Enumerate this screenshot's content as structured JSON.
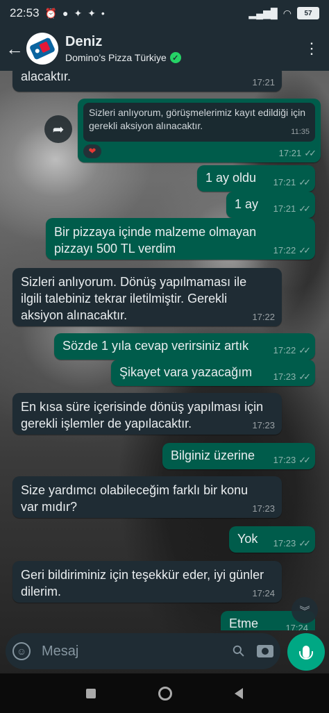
{
  "status": {
    "time": "22:53",
    "battery": "57"
  },
  "header": {
    "name": "Deniz",
    "subtitle": "Domino’s Pizza Türkiye"
  },
  "messages": [
    {
      "dir": "in",
      "text": "alacaktır.",
      "time": "17:21"
    },
    {
      "dir": "out",
      "quoted": "Sizleri anlıyorum, görüşmelerimiz kayıt edildiği için gerekli aksiyon alınacaktır.",
      "quoted_time": "11:35",
      "reaction": "❤",
      "time": "17:21"
    },
    {
      "dir": "out",
      "text": "1 ay oldu",
      "time": "17:21"
    },
    {
      "dir": "out",
      "text": "1 ay",
      "time": "17:21"
    },
    {
      "dir": "out",
      "text": "Bir pizzaya içinde malzeme olmayan pizzayı 500 TL verdim",
      "time": "17:22"
    },
    {
      "dir": "in",
      "text": "Sizleri anlıyorum. Dönüş yapılmaması ile ilgili talebiniz tekrar iletilmiştir. Gerekli aksiyon alınacaktır.",
      "time": "17:22"
    },
    {
      "dir": "out",
      "text": "Sözde 1 yıla cevap verirsiniz artık",
      "time": "17:22"
    },
    {
      "dir": "out",
      "text": "Şikayet vara yazacağım",
      "time": "17:23"
    },
    {
      "dir": "in",
      "text": "En kısa süre içerisinde dönüş yapılması için gerekli işlemler de yapılacaktır.",
      "time": "17:23"
    },
    {
      "dir": "out",
      "text": "Bilginiz üzerine",
      "time": "17:23"
    },
    {
      "dir": "in",
      "text": "Size yardımcı olabileceğim farklı bir konu var mıdır?",
      "time": "17:23"
    },
    {
      "dir": "out",
      "text": "Yok",
      "time": "17:23"
    },
    {
      "dir": "in",
      "text": "Geri bildiriminiz için teşekkür eder, iyi günler dilerim.",
      "time": "17:24"
    },
    {
      "dir": "out",
      "text": "Etme",
      "time": "17:24"
    }
  ],
  "input": {
    "placeholder": "Mesaj"
  },
  "icons": {
    "back": "arrow-left-icon",
    "menu": "more-vertical-icon",
    "forward": "forward-icon",
    "emoji": "emoji-icon",
    "attach": "paperclip-icon",
    "camera": "camera-icon",
    "mic": "microphone-icon"
  },
  "colors": {
    "incoming": "#1f2c34",
    "outgoing": "#005c4b",
    "accent": "#00a884"
  }
}
